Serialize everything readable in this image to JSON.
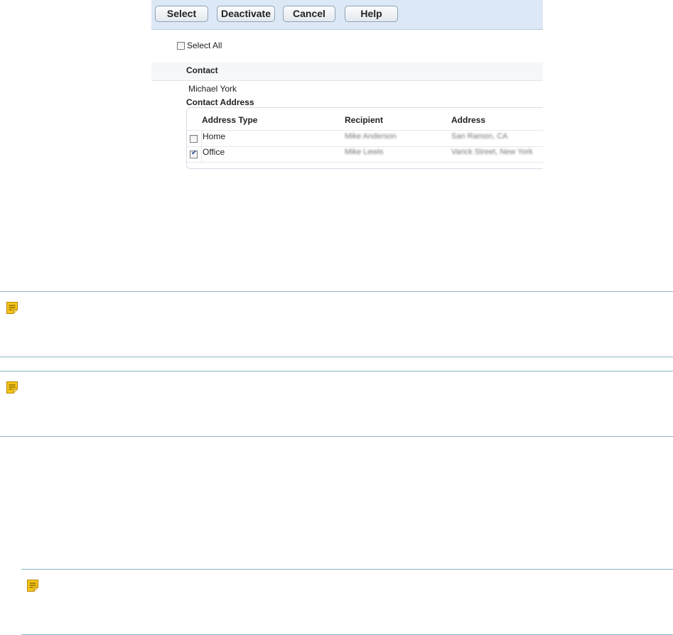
{
  "toolbar": {
    "select_label": "Select",
    "deactivate_label": "Deactivate",
    "cancel_label": "Cancel",
    "help_label": "Help"
  },
  "select_all": {
    "label": "Select All",
    "checked": false
  },
  "contact": {
    "header": "Contact",
    "name": "Michael York"
  },
  "contact_address": {
    "title": "Contact Address",
    "columns": [
      "Address Type",
      "Recipient",
      "Address"
    ],
    "rows": [
      {
        "type": "Home",
        "recipient": "Mike Anderson",
        "address": "San Ramon, CA",
        "checked": false
      },
      {
        "type": "Office",
        "recipient": "Mike Lewis",
        "address": "Varick Street, New York",
        "checked": true
      }
    ]
  },
  "notes": [
    {
      "icon": "note-icon"
    },
    {
      "icon": "note-icon"
    },
    {
      "icon": "note-icon"
    }
  ],
  "colors": {
    "toolbar_bg": "#dde8f6",
    "note_border": "#8fb5c7",
    "note_icon": "#f5c518"
  }
}
